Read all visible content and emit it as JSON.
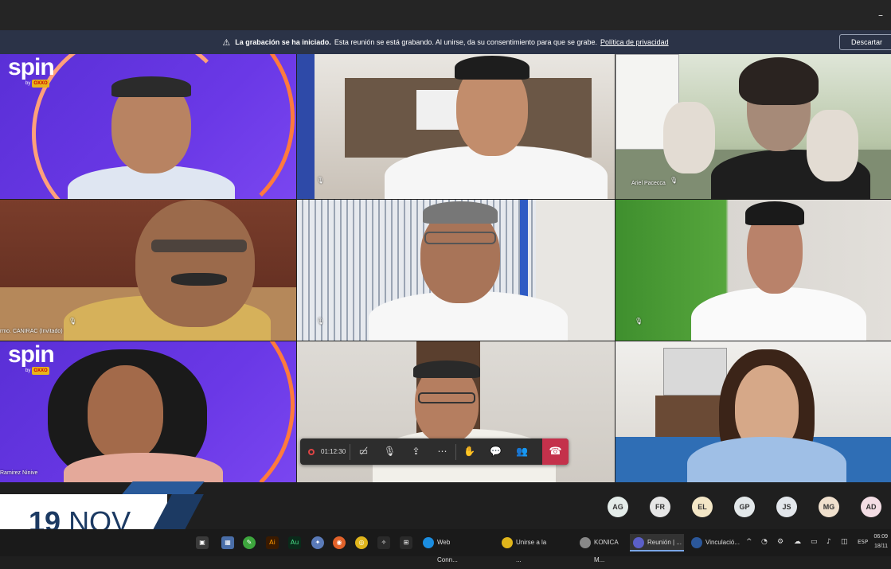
{
  "window": {
    "minimize_glyph": "–"
  },
  "banner": {
    "bold": "La grabación se ha iniciado.",
    "text": "Esta reunión se está grabando. Al unirse, da su consentimiento para que se grabe.",
    "link": "Política de privacidad",
    "dismiss_label": "Descartar"
  },
  "tiles": [
    {
      "label": "",
      "brand": "spin",
      "brand_by": "by",
      "brand_oxxo": "OXXO"
    },
    {
      "label": ""
    },
    {
      "label": "Ariel Pacecca"
    },
    {
      "label": "rmo. CANIRAC (Invitado)"
    },
    {
      "label": ""
    },
    {
      "label": ""
    },
    {
      "label": "Ramirez Ninive",
      "brand": "spin",
      "brand_by": "by",
      "brand_oxxo": "OXXO"
    },
    {
      "label": ""
    },
    {
      "label": ""
    }
  ],
  "callbar": {
    "timer": "01:12:30",
    "icons": [
      "camera-off-icon",
      "mic-off-icon",
      "share-icon",
      "more-icon",
      "raise-hand-icon",
      "chat-icon",
      "participants-icon",
      "hangup-icon"
    ]
  },
  "avatars": [
    {
      "initials": "AG",
      "color": "#e4ece9"
    },
    {
      "initials": "FR",
      "color": "#e6e6e6"
    },
    {
      "initials": "EL",
      "color": "#f3e6c6"
    },
    {
      "initials": "GP",
      "color": "#e3e8ea"
    },
    {
      "initials": "JS",
      "color": "#e3e7ec"
    },
    {
      "initials": "MG",
      "color": "#f0e0cd"
    },
    {
      "initials": "AD",
      "color": "#f3dde4"
    }
  ],
  "date_badge": {
    "day": "19",
    "month": "NOV"
  },
  "taskbar": {
    "apps": [
      {
        "label": "Web Conn...",
        "color": "#1b8de0"
      },
      {
        "label": "Unirse a la ...",
        "color": "#e0b51b"
      },
      {
        "label": "KONICA M...",
        "color": "#888888"
      },
      {
        "label": "Reunión | ...",
        "color": "#5b5fc7"
      },
      {
        "label": "Vinculació...",
        "color": "#2b579a"
      }
    ],
    "tray": {
      "lang": "ESP",
      "time": "06:09",
      "date": "18/11"
    }
  }
}
